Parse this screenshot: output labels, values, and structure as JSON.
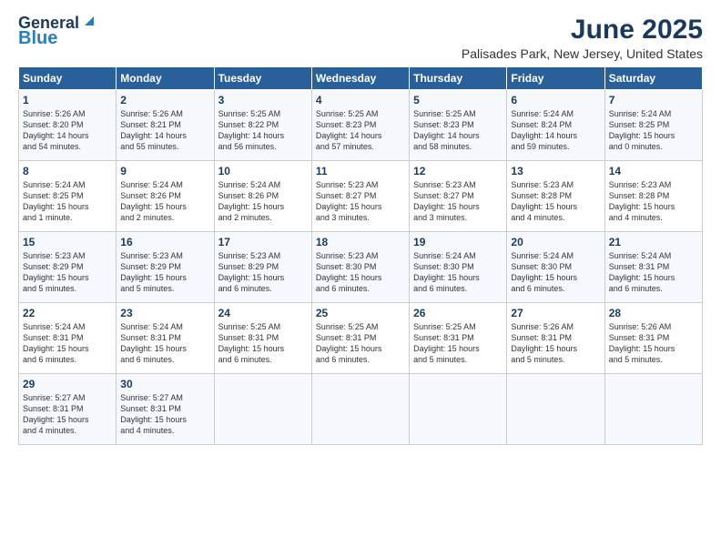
{
  "header": {
    "logo_line1": "General",
    "logo_line2": "Blue",
    "title": "June 2025",
    "subtitle": "Palisades Park, New Jersey, United States"
  },
  "columns": [
    "Sunday",
    "Monday",
    "Tuesday",
    "Wednesday",
    "Thursday",
    "Friday",
    "Saturday"
  ],
  "weeks": [
    [
      {
        "day": "1",
        "info": "Sunrise: 5:26 AM\nSunset: 8:20 PM\nDaylight: 14 hours\nand 54 minutes."
      },
      {
        "day": "2",
        "info": "Sunrise: 5:26 AM\nSunset: 8:21 PM\nDaylight: 14 hours\nand 55 minutes."
      },
      {
        "day": "3",
        "info": "Sunrise: 5:25 AM\nSunset: 8:22 PM\nDaylight: 14 hours\nand 56 minutes."
      },
      {
        "day": "4",
        "info": "Sunrise: 5:25 AM\nSunset: 8:23 PM\nDaylight: 14 hours\nand 57 minutes."
      },
      {
        "day": "5",
        "info": "Sunrise: 5:25 AM\nSunset: 8:23 PM\nDaylight: 14 hours\nand 58 minutes."
      },
      {
        "day": "6",
        "info": "Sunrise: 5:24 AM\nSunset: 8:24 PM\nDaylight: 14 hours\nand 59 minutes."
      },
      {
        "day": "7",
        "info": "Sunrise: 5:24 AM\nSunset: 8:25 PM\nDaylight: 15 hours\nand 0 minutes."
      }
    ],
    [
      {
        "day": "8",
        "info": "Sunrise: 5:24 AM\nSunset: 8:25 PM\nDaylight: 15 hours\nand 1 minute."
      },
      {
        "day": "9",
        "info": "Sunrise: 5:24 AM\nSunset: 8:26 PM\nDaylight: 15 hours\nand 2 minutes."
      },
      {
        "day": "10",
        "info": "Sunrise: 5:24 AM\nSunset: 8:26 PM\nDaylight: 15 hours\nand 2 minutes."
      },
      {
        "day": "11",
        "info": "Sunrise: 5:23 AM\nSunset: 8:27 PM\nDaylight: 15 hours\nand 3 minutes."
      },
      {
        "day": "12",
        "info": "Sunrise: 5:23 AM\nSunset: 8:27 PM\nDaylight: 15 hours\nand 3 minutes."
      },
      {
        "day": "13",
        "info": "Sunrise: 5:23 AM\nSunset: 8:28 PM\nDaylight: 15 hours\nand 4 minutes."
      },
      {
        "day": "14",
        "info": "Sunrise: 5:23 AM\nSunset: 8:28 PM\nDaylight: 15 hours\nand 4 minutes."
      }
    ],
    [
      {
        "day": "15",
        "info": "Sunrise: 5:23 AM\nSunset: 8:29 PM\nDaylight: 15 hours\nand 5 minutes."
      },
      {
        "day": "16",
        "info": "Sunrise: 5:23 AM\nSunset: 8:29 PM\nDaylight: 15 hours\nand 5 minutes."
      },
      {
        "day": "17",
        "info": "Sunrise: 5:23 AM\nSunset: 8:29 PM\nDaylight: 15 hours\nand 6 minutes."
      },
      {
        "day": "18",
        "info": "Sunrise: 5:23 AM\nSunset: 8:30 PM\nDaylight: 15 hours\nand 6 minutes."
      },
      {
        "day": "19",
        "info": "Sunrise: 5:24 AM\nSunset: 8:30 PM\nDaylight: 15 hours\nand 6 minutes."
      },
      {
        "day": "20",
        "info": "Sunrise: 5:24 AM\nSunset: 8:30 PM\nDaylight: 15 hours\nand 6 minutes."
      },
      {
        "day": "21",
        "info": "Sunrise: 5:24 AM\nSunset: 8:31 PM\nDaylight: 15 hours\nand 6 minutes."
      }
    ],
    [
      {
        "day": "22",
        "info": "Sunrise: 5:24 AM\nSunset: 8:31 PM\nDaylight: 15 hours\nand 6 minutes."
      },
      {
        "day": "23",
        "info": "Sunrise: 5:24 AM\nSunset: 8:31 PM\nDaylight: 15 hours\nand 6 minutes."
      },
      {
        "day": "24",
        "info": "Sunrise: 5:25 AM\nSunset: 8:31 PM\nDaylight: 15 hours\nand 6 minutes."
      },
      {
        "day": "25",
        "info": "Sunrise: 5:25 AM\nSunset: 8:31 PM\nDaylight: 15 hours\nand 6 minutes."
      },
      {
        "day": "26",
        "info": "Sunrise: 5:25 AM\nSunset: 8:31 PM\nDaylight: 15 hours\nand 5 minutes."
      },
      {
        "day": "27",
        "info": "Sunrise: 5:26 AM\nSunset: 8:31 PM\nDaylight: 15 hours\nand 5 minutes."
      },
      {
        "day": "28",
        "info": "Sunrise: 5:26 AM\nSunset: 8:31 PM\nDaylight: 15 hours\nand 5 minutes."
      }
    ],
    [
      {
        "day": "29",
        "info": "Sunrise: 5:27 AM\nSunset: 8:31 PM\nDaylight: 15 hours\nand 4 minutes."
      },
      {
        "day": "30",
        "info": "Sunrise: 5:27 AM\nSunset: 8:31 PM\nDaylight: 15 hours\nand 4 minutes."
      },
      {
        "day": "",
        "info": ""
      },
      {
        "day": "",
        "info": ""
      },
      {
        "day": "",
        "info": ""
      },
      {
        "day": "",
        "info": ""
      },
      {
        "day": "",
        "info": ""
      }
    ]
  ]
}
